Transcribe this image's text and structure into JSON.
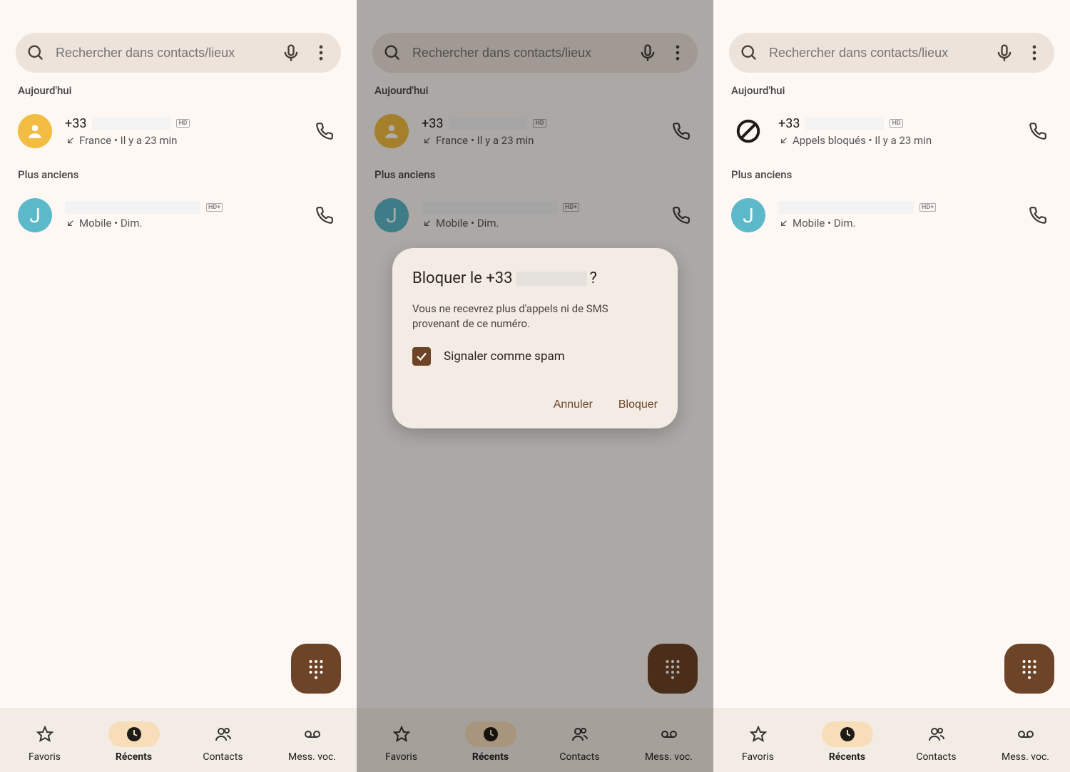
{
  "search": {
    "placeholder": "Rechercher dans contacts/lieux"
  },
  "sections": {
    "today": "Aujourd'hui",
    "older": "Plus anciens"
  },
  "calls": {
    "first": {
      "prefix": "+33",
      "sub_normal": "France • Il y a 23 min",
      "sub_blocked": "Appels bloqués • Il y a 23 min",
      "hd": "HD"
    },
    "second": {
      "initial": "J",
      "sub": "Mobile • Dim.",
      "hd": "HD+"
    }
  },
  "nav": {
    "favorites": "Favoris",
    "recents": "Récents",
    "contacts": "Contacts",
    "voicemail": "Mess. voc."
  },
  "dialog": {
    "title_pre": "Bloquer le +33",
    "title_post": "?",
    "body": "Vous ne recevrez plus d'appels ni de SMS provenant de ce numéro.",
    "check_label": "Signaler comme spam",
    "cancel": "Annuler",
    "block": "Bloquer"
  }
}
